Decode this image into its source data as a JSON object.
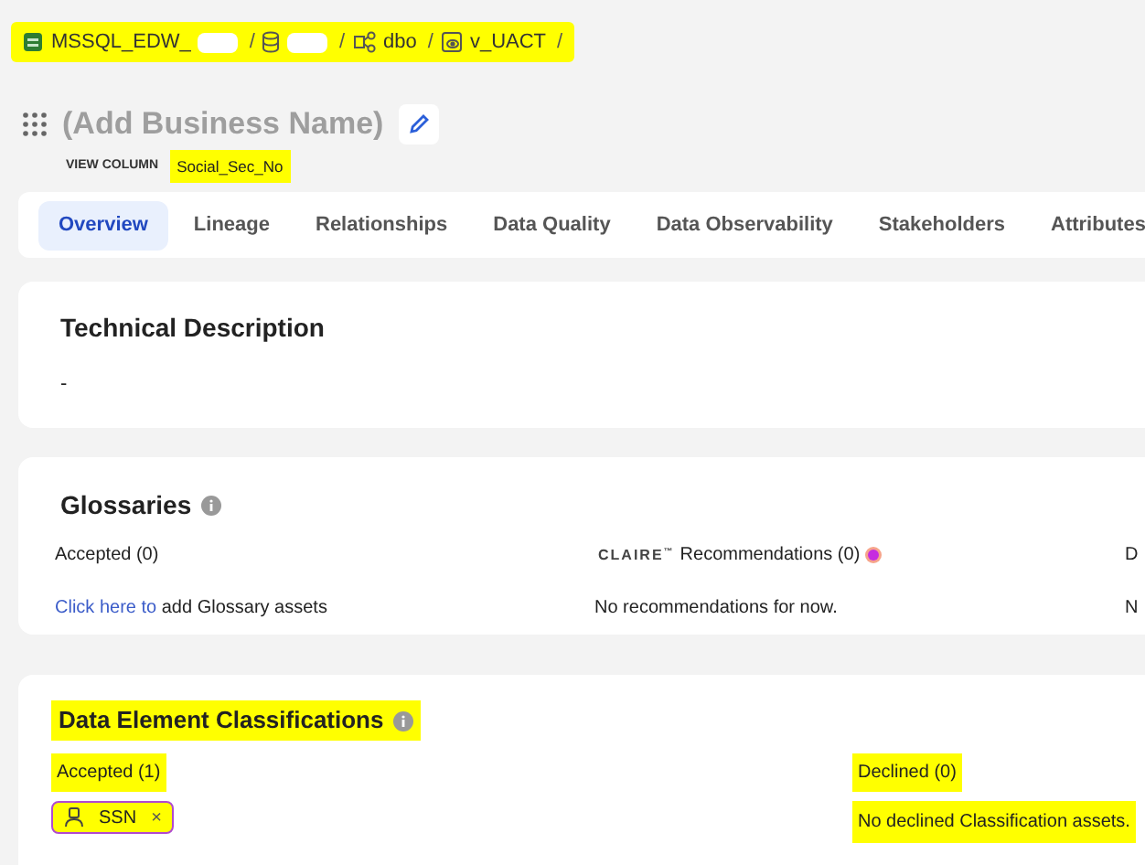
{
  "breadcrumb": {
    "highlighted": true,
    "items": [
      {
        "kind": "source",
        "label": "MSSQL_EDW_",
        "redacted": true,
        "separator": "/"
      },
      {
        "kind": "database",
        "redacted": true,
        "separator": "/"
      },
      {
        "kind": "schema",
        "label": "dbo",
        "redacted": false,
        "separator": "/"
      },
      {
        "kind": "view",
        "label": "v_UACT",
        "redacted": false,
        "separator": "/"
      }
    ]
  },
  "title": "(Add Business Name)",
  "view_column": {
    "label": "VIEW COLUMN",
    "value": "Social_Sec_No",
    "highlighted": true
  },
  "tabs": [
    {
      "label": "Overview",
      "selected": true
    },
    {
      "label": "Lineage",
      "selected": false
    },
    {
      "label": "Relationships",
      "selected": false
    },
    {
      "label": "Data Quality",
      "selected": false
    },
    {
      "label": "Data Observability",
      "selected": false
    },
    {
      "label": "Stakeholders",
      "selected": false
    },
    {
      "label": "Attributes",
      "selected": false
    }
  ],
  "technical_description": {
    "title": "Technical Description",
    "value": "-"
  },
  "glossaries": {
    "title": "Glossaries",
    "accepted": {
      "label": "Accepted (0)",
      "link": "Click here to",
      "text": " add Glossary assets"
    },
    "recommendations": {
      "brand": "CLAIRE",
      "trademark": "™",
      "label": "Recommendations (0)",
      "text": "No recommendations for now."
    },
    "column_3": {
      "label": "D",
      "text": "N"
    }
  },
  "classifications": {
    "title": "Data Element Classifications",
    "highlighted": true,
    "accepted": {
      "label": "Accepted (1)",
      "tags": [
        {
          "label": "SSN",
          "remove": "×"
        }
      ]
    },
    "declined": {
      "label": "Declined (0)",
      "text": "No declined Classification assets."
    }
  }
}
